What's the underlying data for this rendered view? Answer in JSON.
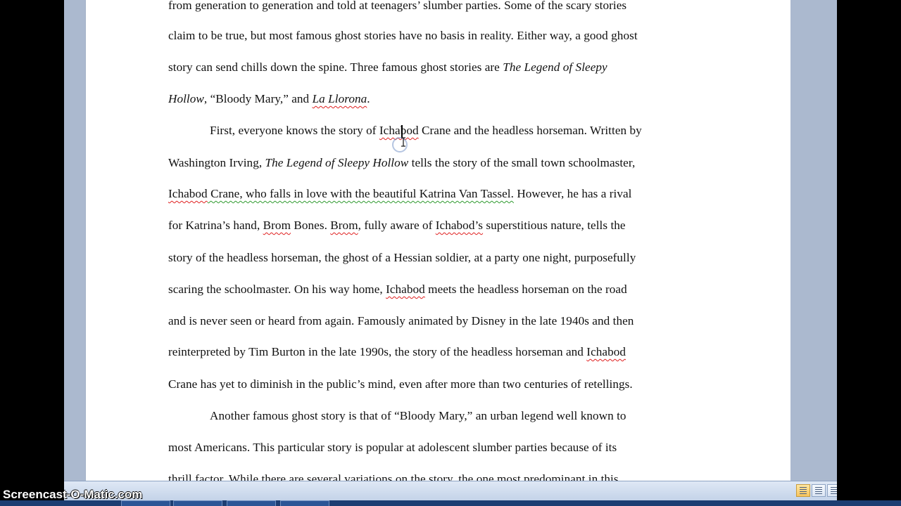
{
  "document": {
    "lines": [
      "from generation to generation and told at teenagers’ slumber parties.  Some of the scary stories",
      "claim to be true, but most famous ghost stories have no basis in reality.  Either way, a good ghost",
      "story can send chills down the spine.  Three  famous ghost stories are ",
      "The Legend of Sleepy",
      "Hollow",
      ", “Bloody Mary,” and ",
      "La Llorona",
      ".",
      "First, everyone knows the story of ",
      "Ichabod",
      " Crane and the headless horseman.   Written by",
      "Washington Irving, ",
      "The Legend of Sleepy Hollow",
      " tells the story of the small  town schoolmaster,",
      "Ichabod",
      " Crane, who falls in love with the beautiful Katrina Van Tassel.",
      "  However, he has a rival",
      "for Katrina’s hand, ",
      "Brom",
      " Bones.  ",
      "Brom",
      ", fully aware of ",
      "Ichabod’s",
      " superstitious nature, tells the",
      "story of the headless horseman, the ghost of a Hessian soldier, at a party one night, purposefully",
      "scaring the schoolmaster.  On his way home, ",
      "Ichabod",
      " meets the headless horseman  on the road",
      "and is never seen or heard from again.  Famously  animated by Disney in the late 1940s and then",
      "reinterpreted by Tim  Burton in the late 1990s, the story of the headless horseman and ",
      "Ichabod",
      "Crane has yet to diminish in the public’s mind, even after more than two centuries of retellings.",
      "Another famous ghost story is that of “Bloody Mary,” an urban legend well known to",
      "most Americans.  This  particular story is popular at adolescent slumber parties because of its",
      "thrill factor.  While there are several variations  on the story, the one most predominant in this"
    ]
  },
  "watermark": "Screencast-O-Matic.com",
  "colors": {
    "app_background": "#abb9cf",
    "page": "#ffffff",
    "spelling_underline": "#e02020",
    "grammar_underline": "#2e9a2e"
  }
}
